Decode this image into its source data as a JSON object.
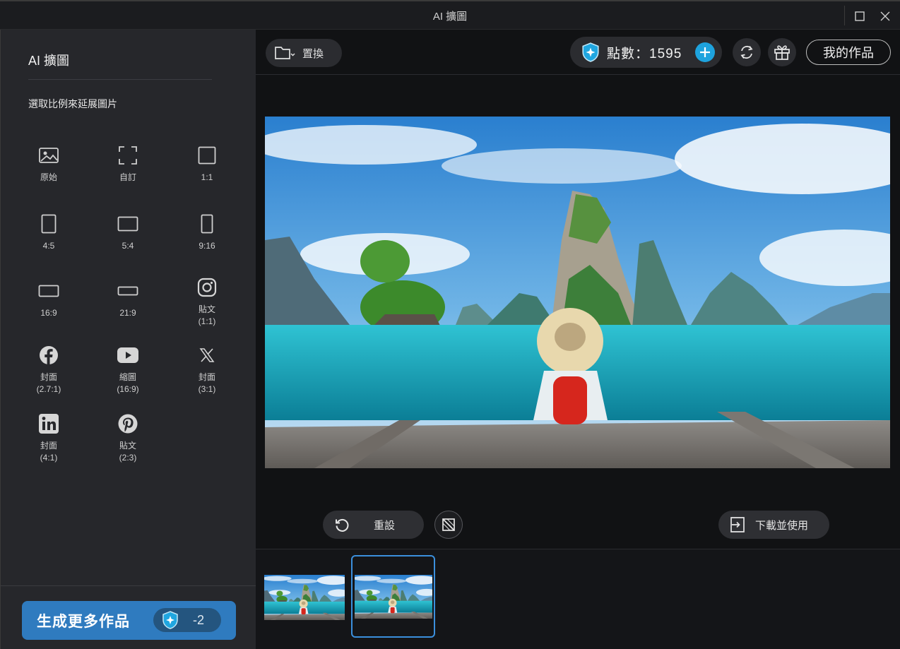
{
  "window": {
    "title": "AI 擴圖",
    "icons": {
      "maximize": "maximize-icon",
      "close": "close-icon"
    }
  },
  "sidebar": {
    "heading": "AI 擴圖",
    "subheading": "選取比例來延展圖片",
    "ratios": [
      {
        "label": "原始",
        "icon": "image-icon"
      },
      {
        "label": "自訂",
        "icon": "custom-frame-icon"
      },
      {
        "label": "1:1",
        "icon": "square-icon"
      },
      {
        "label": "4:5",
        "icon": "portrait-4-5-icon"
      },
      {
        "label": "5:4",
        "icon": "landscape-5-4-icon"
      },
      {
        "label": "9:16",
        "icon": "portrait-9-16-icon"
      },
      {
        "label": "16:9",
        "icon": "landscape-16-9-icon"
      },
      {
        "label": "21:9",
        "icon": "landscape-21-9-icon"
      },
      {
        "label": "貼文\n(1:1)",
        "icon": "instagram-icon"
      },
      {
        "label": "封面\n(2.7:1)",
        "icon": "facebook-icon"
      },
      {
        "label": "縮圖\n(16:9)",
        "icon": "youtube-icon"
      },
      {
        "label": "封面\n(3:1)",
        "icon": "x-icon"
      },
      {
        "label": "封面\n(4:1)",
        "icon": "linkedin-icon"
      },
      {
        "label": "貼文\n(2:3)",
        "icon": "pinterest-icon"
      }
    ],
    "generate_button": {
      "label": "生成更多作品",
      "cost": "-2"
    }
  },
  "toolbar": {
    "replace_label": "置換",
    "points_text": "點數：1595",
    "my_works_label": "我的作品",
    "icons": [
      "folder-icon",
      "credit-icon",
      "add-icon",
      "refresh-icon",
      "gift-icon"
    ]
  },
  "canvas": {
    "reset_label": "重設",
    "download_label": "下載並使用",
    "icons": [
      "reset-icon",
      "compare-icon",
      "download-icon"
    ]
  },
  "thumbnails": {
    "count": 2,
    "selected_index": 1
  },
  "colors": {
    "accent": "#2f7bbf",
    "selection": "#3b8fdc",
    "sidebar_bg": "#26272b",
    "app_bg": "#111214"
  }
}
